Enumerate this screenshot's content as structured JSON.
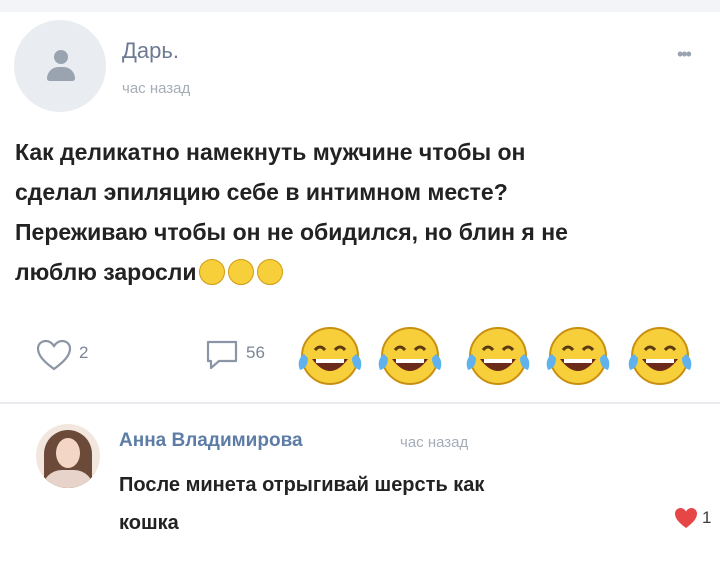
{
  "post": {
    "author": "Дарь.",
    "time": "час назад",
    "text_lines": [
      "Как деликатно намекнуть мужчине чтобы он",
      "сделал эпиляцию себе в интимном месте?",
      "Переживаю чтобы он не обидился, но блин я не",
      "люблю заросли"
    ],
    "inline_emoji": [
      "grimacing-emoji",
      "grimacing-emoji",
      "grimacing-emoji"
    ]
  },
  "actions": {
    "likes": "2",
    "comments": "56",
    "reaction_emoji": [
      "laughing-tears-emoji",
      "laughing-tears-emoji",
      "laughing-tears-emoji",
      "laughing-tears-emoji",
      "laughing-tears-emoji"
    ]
  },
  "comment": {
    "author": "Анна Владимирова",
    "time": "час назад",
    "text_lines": [
      "После минета отрыгивай шерсть как",
      "кошка"
    ],
    "likes": "1"
  },
  "colors": {
    "author_link": "#5d7ca6",
    "muted": "#a6adb8",
    "like_red": "#e64646",
    "emoji_yellow": "#f7cf3b"
  }
}
